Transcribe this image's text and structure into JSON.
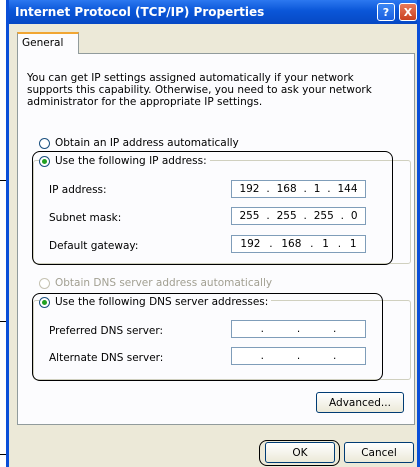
{
  "window": {
    "title": "Internet Protocol (TCP/IP) Properties",
    "help_glyph": "?",
    "close_glyph": "X"
  },
  "tabs": [
    {
      "label": "General"
    }
  ],
  "description": "You can get IP settings assigned automatically if your network supports this capability. Otherwise, you need to ask your network administrator for the appropriate IP settings.",
  "ip": {
    "auto_label": "Obtain an IP address automatically",
    "manual_label": "Use the following IP address:",
    "selected": "manual",
    "fields": [
      {
        "label": "IP address:",
        "octets": [
          "192",
          "168",
          "1",
          "144"
        ]
      },
      {
        "label": "Subnet mask:",
        "octets": [
          "255",
          "255",
          "255",
          "0"
        ]
      },
      {
        "label": "Default gateway:",
        "octets": [
          "192",
          "168",
          "1",
          "1"
        ]
      }
    ]
  },
  "dns": {
    "auto_label": "Obtain DNS server address automatically",
    "manual_label": "Use the following DNS server addresses:",
    "selected": "manual",
    "fields": [
      {
        "label": "Preferred DNS server:",
        "octets": [
          "",
          "",
          "",
          ""
        ]
      },
      {
        "label": "Alternate DNS server:",
        "octets": [
          "",
          "",
          "",
          ""
        ]
      }
    ]
  },
  "buttons": {
    "advanced": "Advanced...",
    "ok": "OK",
    "cancel": "Cancel"
  },
  "colors": {
    "title_bar": "#0a56d8",
    "dialog_bg": "#ece9d8",
    "radio_selected": "#21a121"
  }
}
